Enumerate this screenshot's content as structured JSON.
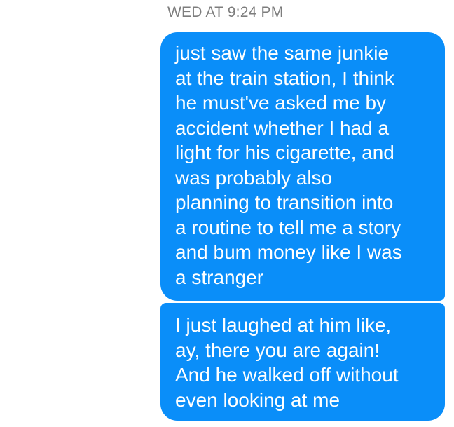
{
  "conversation": {
    "timestamp": "WED AT 9:24 PM",
    "messages": [
      {
        "sender": "me",
        "text": "just saw the same junkie\nat the train station, I think\nhe must've asked me by\naccident whether I had a\nlight for his cigarette, and\nwas probably also\nplanning to transition into\na routine to tell me a story\nand bum money like I was\na stranger"
      },
      {
        "sender": "me",
        "text": "I just laughed at him like,\nay, there you are again!\nAnd he walked off without\neven looking at me"
      }
    ],
    "colors": {
      "bubble": "#0a8ef9",
      "bubble_text": "#ffffff",
      "timestamp": "#7d7d7d"
    }
  }
}
